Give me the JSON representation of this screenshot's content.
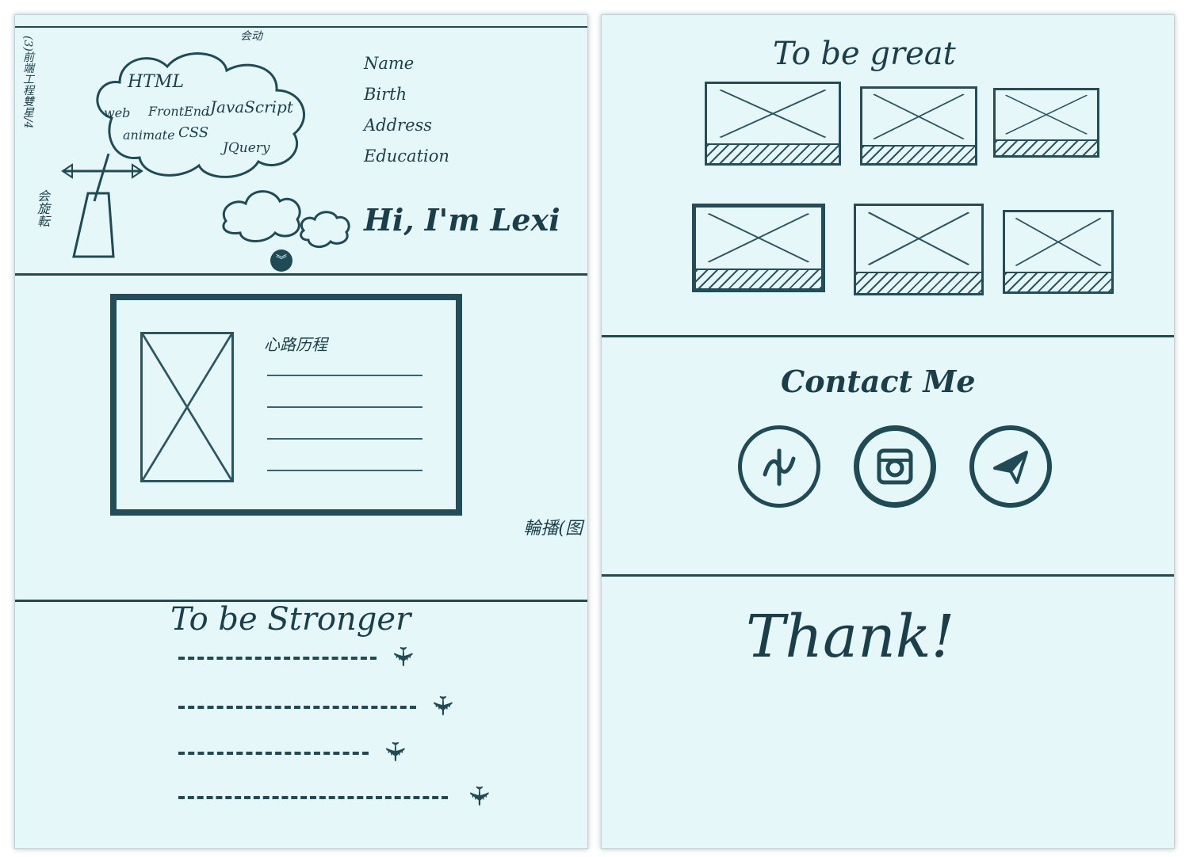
{
  "left_page": {
    "header_sketch": {
      "top_note": "(3)前端工程雙星/4",
      "cloud_note": "会动",
      "rotate_note": "会旋転",
      "skills": [
        "HTML",
        "web",
        "FrontEnd",
        "JavaScript",
        "animate",
        "CSS",
        "JQuery"
      ],
      "profile_fields": [
        "Name",
        "Birth",
        "Address",
        "Education"
      ],
      "greeting": "Hi, I'm Lexi"
    },
    "carousel": {
      "title": "心路历程",
      "note": "輪播(图"
    },
    "stronger_section": {
      "title": "To be Stronger",
      "rows": 4
    }
  },
  "right_page": {
    "great_section": {
      "title": "To be great",
      "thumbnails": 6
    },
    "contact_section": {
      "title": "Contact Me",
      "icons": [
        "facebook-icon",
        "instagram-icon",
        "send-plane-icon"
      ]
    },
    "footer": {
      "message": "Thank!"
    }
  },
  "colors": {
    "paper": "#e6f7f9",
    "pencil": "#1f4b57"
  }
}
